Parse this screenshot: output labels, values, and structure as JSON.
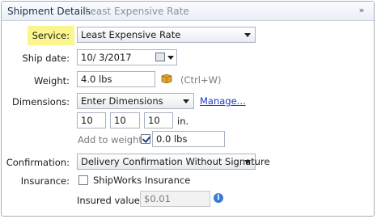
{
  "header": {
    "title": "Shipment Details",
    "subtitle": "Least Expensive Rate"
  },
  "service": {
    "label": "Service:",
    "value": "Least Expensive Rate"
  },
  "ship_date": {
    "label": "Ship date:",
    "value": "10/  3/2017"
  },
  "weight": {
    "label": "Weight:",
    "value": "4.0 lbs",
    "hint": "(Ctrl+W)"
  },
  "dimensions": {
    "label": "Dimensions:",
    "value": "Enter Dimensions",
    "manage_link": "Manage...",
    "length": "10",
    "width": "10",
    "height": "10",
    "unit": "in.",
    "add_to_weight_label": "Add to weight",
    "add_to_weight_checked": true,
    "add_weight_value": "0.0 lbs"
  },
  "confirmation": {
    "label": "Confirmation:",
    "value": "Delivery Confirmation Without Signature"
  },
  "insurance": {
    "label": "Insurance:",
    "checkbox_label": "ShipWorks Insurance",
    "checked": false,
    "insured_value_label": "Insured value:",
    "insured_value": "$0.01"
  },
  "colors": {
    "highlight": "#fbf68c",
    "link": "#1c3ac2"
  }
}
